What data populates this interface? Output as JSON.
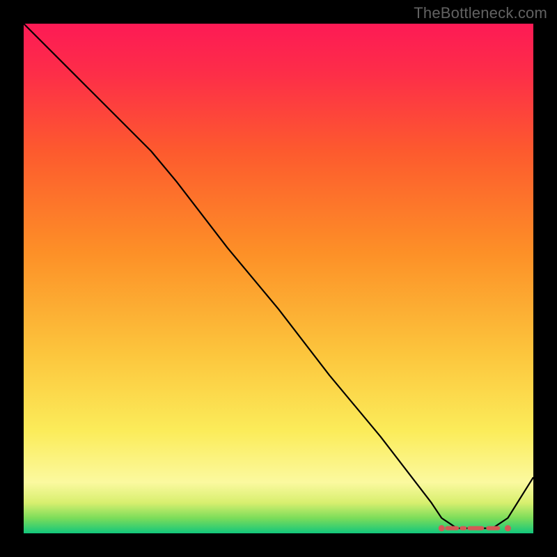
{
  "watermark": "TheBottleneck.com",
  "chart_data": {
    "type": "line",
    "title": "",
    "xlabel": "",
    "ylabel": "",
    "xlim": [
      0,
      100
    ],
    "ylim": [
      0,
      100
    ],
    "x": [
      0,
      10,
      20,
      25,
      30,
      40,
      50,
      60,
      70,
      80,
      82,
      85,
      88,
      90,
      92,
      95,
      100
    ],
    "values": [
      100,
      90,
      80,
      75,
      69,
      56,
      44,
      31,
      19,
      6,
      3,
      1,
      1,
      1,
      1,
      3,
      11
    ],
    "optimal_band": {
      "x_start": 82,
      "x_end": 95,
      "y": 1
    },
    "gradient_stops": [
      {
        "offset": 0.0,
        "color": "#12c77c"
      },
      {
        "offset": 0.03,
        "color": "#7cdd5a"
      },
      {
        "offset": 0.06,
        "color": "#d8ef6f"
      },
      {
        "offset": 0.1,
        "color": "#fbf99f"
      },
      {
        "offset": 0.2,
        "color": "#fbec5a"
      },
      {
        "offset": 0.35,
        "color": "#fcc63d"
      },
      {
        "offset": 0.55,
        "color": "#fd9027"
      },
      {
        "offset": 0.75,
        "color": "#fd5a2e"
      },
      {
        "offset": 0.9,
        "color": "#fd2e48"
      },
      {
        "offset": 1.0,
        "color": "#fd1a55"
      }
    ],
    "line_color": "#000000",
    "marker_color": "#d35a56"
  }
}
